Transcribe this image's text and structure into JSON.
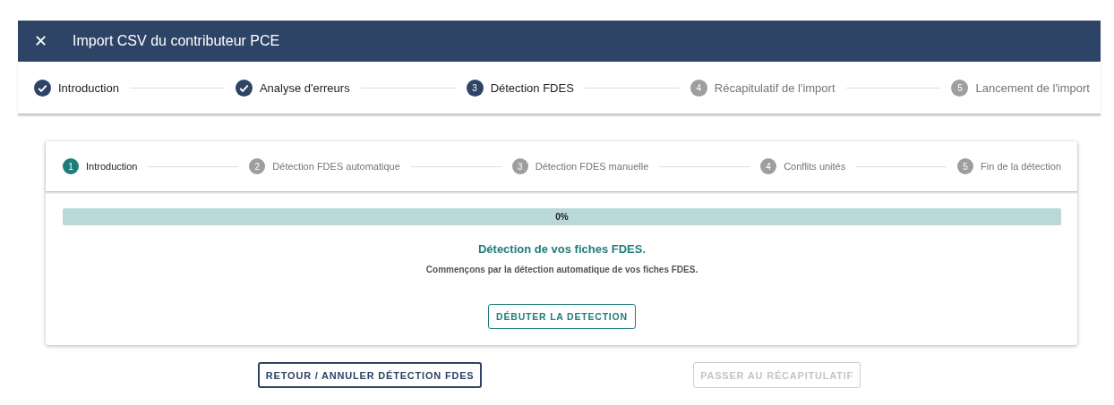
{
  "dialog": {
    "title": "Import CSV du contributeur PCE",
    "close": "✕"
  },
  "steps": [
    {
      "label": "Introduction",
      "completed": true,
      "selected": false
    },
    {
      "label": "Analyse d'erreurs",
      "completed": true,
      "selected": false
    },
    {
      "number": "3",
      "label": "Détection FDES",
      "completed": false,
      "selected": true
    },
    {
      "number": "4",
      "label": "Récapitulatif de l'import",
      "completed": false,
      "selected": false
    },
    {
      "number": "5",
      "label": "Lancement de l'import",
      "completed": false,
      "selected": false
    }
  ],
  "substeps": [
    {
      "number": "1",
      "label": "Introduction",
      "selected": true
    },
    {
      "number": "2",
      "label": "Détection FDES automatique",
      "selected": false
    },
    {
      "number": "3",
      "label": "Détection FDES manuelle",
      "selected": false
    },
    {
      "number": "4",
      "label": "Conflits unités",
      "selected": false
    },
    {
      "number": "5",
      "label": "Fin de la détection",
      "selected": false
    }
  ],
  "progress": {
    "level": 0,
    "reading": "0%"
  },
  "heading": "Détection de vos fiches FDES.",
  "description": "Commençons par la détection automatique de vos fiches FDES.",
  "start_button": "DÉBUTER LA DETECTION",
  "buttons": [
    {
      "label": "RETOUR / ANNULER DÉTECTION FDES",
      "disabled": false
    },
    {
      "label": "PASSER AU RÉCAPITULATIF",
      "disabled": true
    }
  ]
}
